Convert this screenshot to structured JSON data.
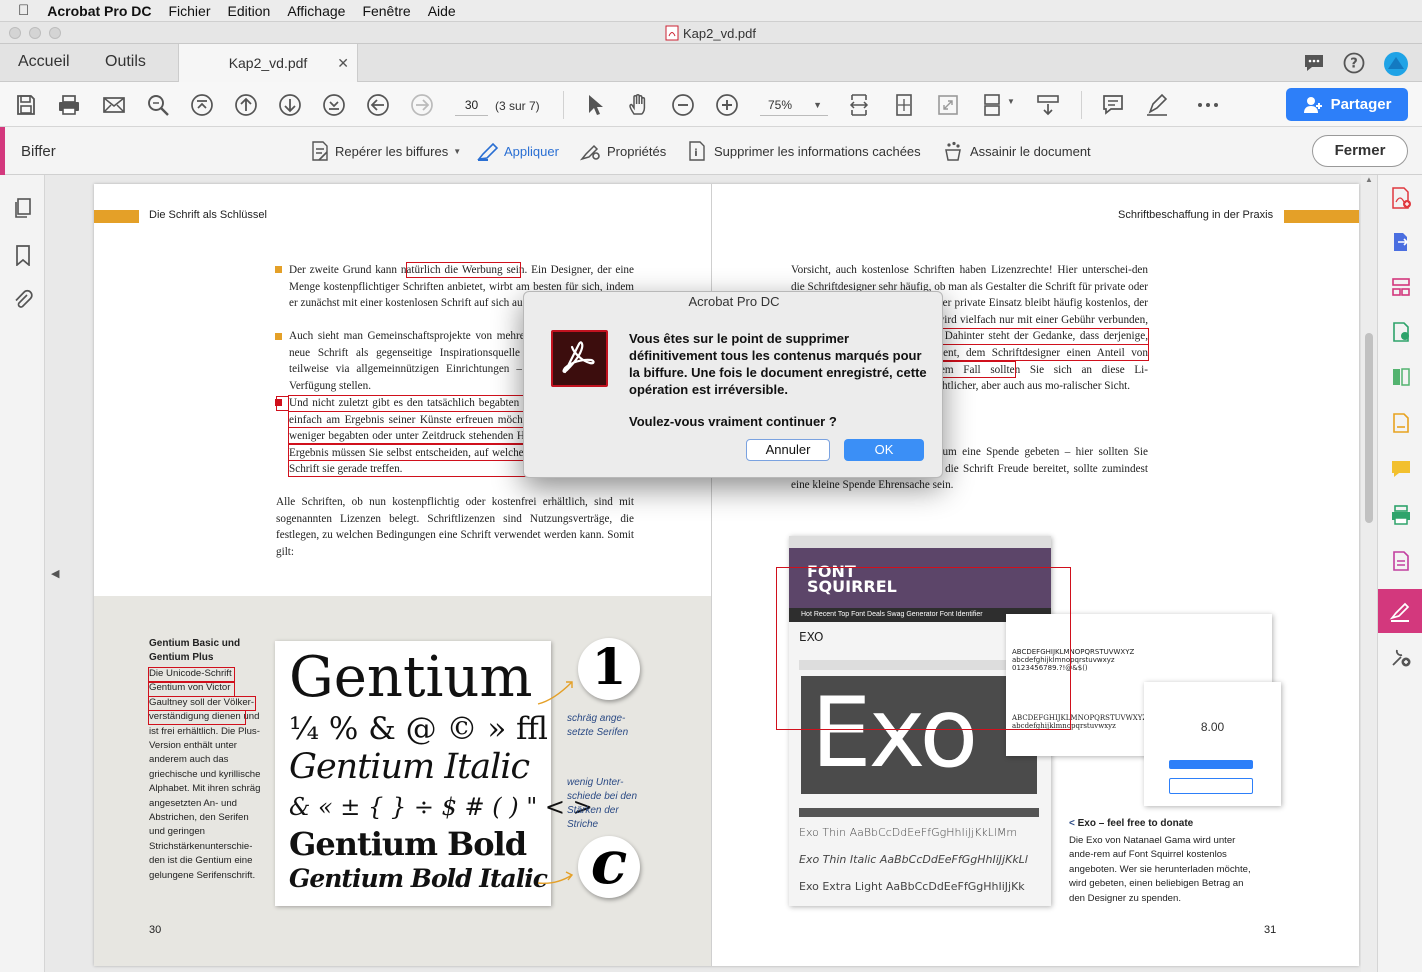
{
  "menubar": {
    "app": "Acrobat Pro DC",
    "items": [
      "Fichier",
      "Edition",
      "Affichage",
      "Fenêtre",
      "Aide"
    ]
  },
  "window": {
    "title": "Kap2_vd.pdf"
  },
  "tabs": {
    "home": "Accueil",
    "tools": "Outils",
    "document": "Kap2_vd.pdf"
  },
  "toolbar": {
    "page_current": "30",
    "page_count": "(3 sur 7)",
    "zoom": "75%",
    "share": "Partager"
  },
  "redact": {
    "title": "Biffer",
    "mark": "Repérer les biffures",
    "apply": "Appliquer",
    "properties": "Propriétés",
    "remove_hidden": "Supprimer les informations cachées",
    "sanitize": "Assainir le document",
    "close": "Fermer"
  },
  "doc": {
    "left_head": "Die Schrift als Schlüssel",
    "right_head": "Schriftbeschaffung in der Praxis",
    "left_p1": "Der zweite Grund kann natürlich die Werbung sein. Ein Designer, der eine Menge kostenpflichtiger Schriften anbietet, wirbt am besten für sich, indem er zunächst mit einer kostenlosen Schrift auf sich aufmerksam macht.",
    "left_p2": "Auch sieht man Gemeinschaftsprojekte von mehreren Designern, die eine neue Schrift als gegenseitige Inspirationsquelle erstellen und diese – teilweise via allgemeinnützigen Einrichtungen – der Öffentlichkeit zur Verfügung stellen.",
    "left_p3": "Und nicht zuletzt gibt es den tatsächlich begabten Schriftgestalter, der sich einfach am Ergebnis seiner Künste erfreuen möchte – und eben auch den weniger begabten oder unter Zeitdruck stehenden Hobbytypografen, und im Ergebnis müssen Sie selbst entscheiden, auf welche Spezies und auf welche Schrift sie gerade treffen.",
    "left_p4": "Alle Schriften, ob nun kostenpflichtig oder kostenfrei erhältlich, sind mit sogenannten Lizenzen belegt. Schriftlizenzen sind Nutzungsverträge, die festlegen, zu welchen Bedingungen eine Schrift verwendet werden kann. Somit gilt:",
    "right_p1": "Vorsicht, auch kostenlose Schriften haben Lizenzrechte! Hier unterschei-den die Schriftdesigner sehr häufig, ob man als Gestalter die Schrift für private oder kommerzielle Zwecke einsetzt. Der private Einsatz bleibt häufig kostenlos, der kommerzielle Einsatz hingegen wird vielfach nur mit einer Gebühr verbunden, ist mit einer Gebühr verbunden. Dahinter steht der Gedanke, dass derjenige, der durch den Ge-brauch verdient, dem Schriftdesigner einen Anteil von seinem Gewinn gibt. In jedem Fall sollten Sie sich an diese Li-zenzbedingungen halten – aus rechtlicher, aber auch aus mo-ralischer Sicht.",
    "right_p2": "Bei kostenlosen Schriften wird um eine Spende gebeten – hier sollten Sie dieser Bitte nachkommen. Wenn die Schrift Freude bereitet, sollte zumindest eine kleine Spende Ehrensache sein.",
    "gentium_title": "Gentium Basic und Gentium Plus",
    "gentium_text": "Die Unicode-Schrift Gentium von Victor Gaultney soll der Völker-verständigung dienen und ist frei erhältlich. Die Plus-Version enthält unter anderem auch das griechische und kyrillische Alphabet. Mit ihren schräg angesetzten An- und Abstrichen, den Serifen und geringen Strichstärkenunterschie-den ist die Gentium eine gelungene Serifenschrift.",
    "gentium_lines": [
      "Gentium",
      "¼ % & @ © » ffl",
      "Gentium Italic",
      "& « ± { } ÷ $ # ( ) \" < >",
      "Gentium Bold",
      "Gentium Bold Italic"
    ],
    "note1": "schräg ange-setzte Serifen",
    "note2": "wenig Unter-schiede bei den Stärken der Striche",
    "circle1": "1",
    "circle2": "c",
    "exo_caption_title": "Exo – feel free to donate",
    "exo_caption": "Die Exo von Natanael Gama wird unter ande-rem auf Font Squirrel kostenlos angeboten. Wer sie herunterladen möchte, wird gebeten, einen beliebigen Betrag an den Designer zu spenden.",
    "page_left": "30",
    "page_right": "31",
    "exo_big": "Exo",
    "exo_label": "EXO",
    "fs_logo": "FONT SQUIRREL",
    "fs_nav": "Hot   Recent   Top Font Deals   Swag   Generator   Font Identifier",
    "exo_samples": [
      "Exo Thin AaBbCcDdEeFfGgHhIiJjKkLlMm",
      "Exo Thin Italic AaBbCcDdEeFfGgHhIiJjKkLl",
      "Exo Extra Light AaBbCcDdEeFfGgHhIiJjKk"
    ],
    "abc_upper": "ABCDEFGHIJKLMNOPQRSTUVWXYZ",
    "abc_lower": "abcdefghijklmnopqrstuvwxyz",
    "digits": "0123456789.?!@&$()",
    "donate_amount": "8.00"
  },
  "dialog": {
    "title": "Acrobat Pro DC",
    "message": "Vous êtes sur le point de supprimer définitivement tous les contenus marqués pour la biffure. Une fois le document enregistré, cette opération est irréversible.",
    "question": "Voulez-vous vraiment continuer ?",
    "cancel": "Annuler",
    "ok": "OK"
  },
  "colors": {
    "accent": "#d3387d",
    "primary": "#2d7ff9",
    "redact": "#d0101c",
    "orange": "#e4a028"
  }
}
